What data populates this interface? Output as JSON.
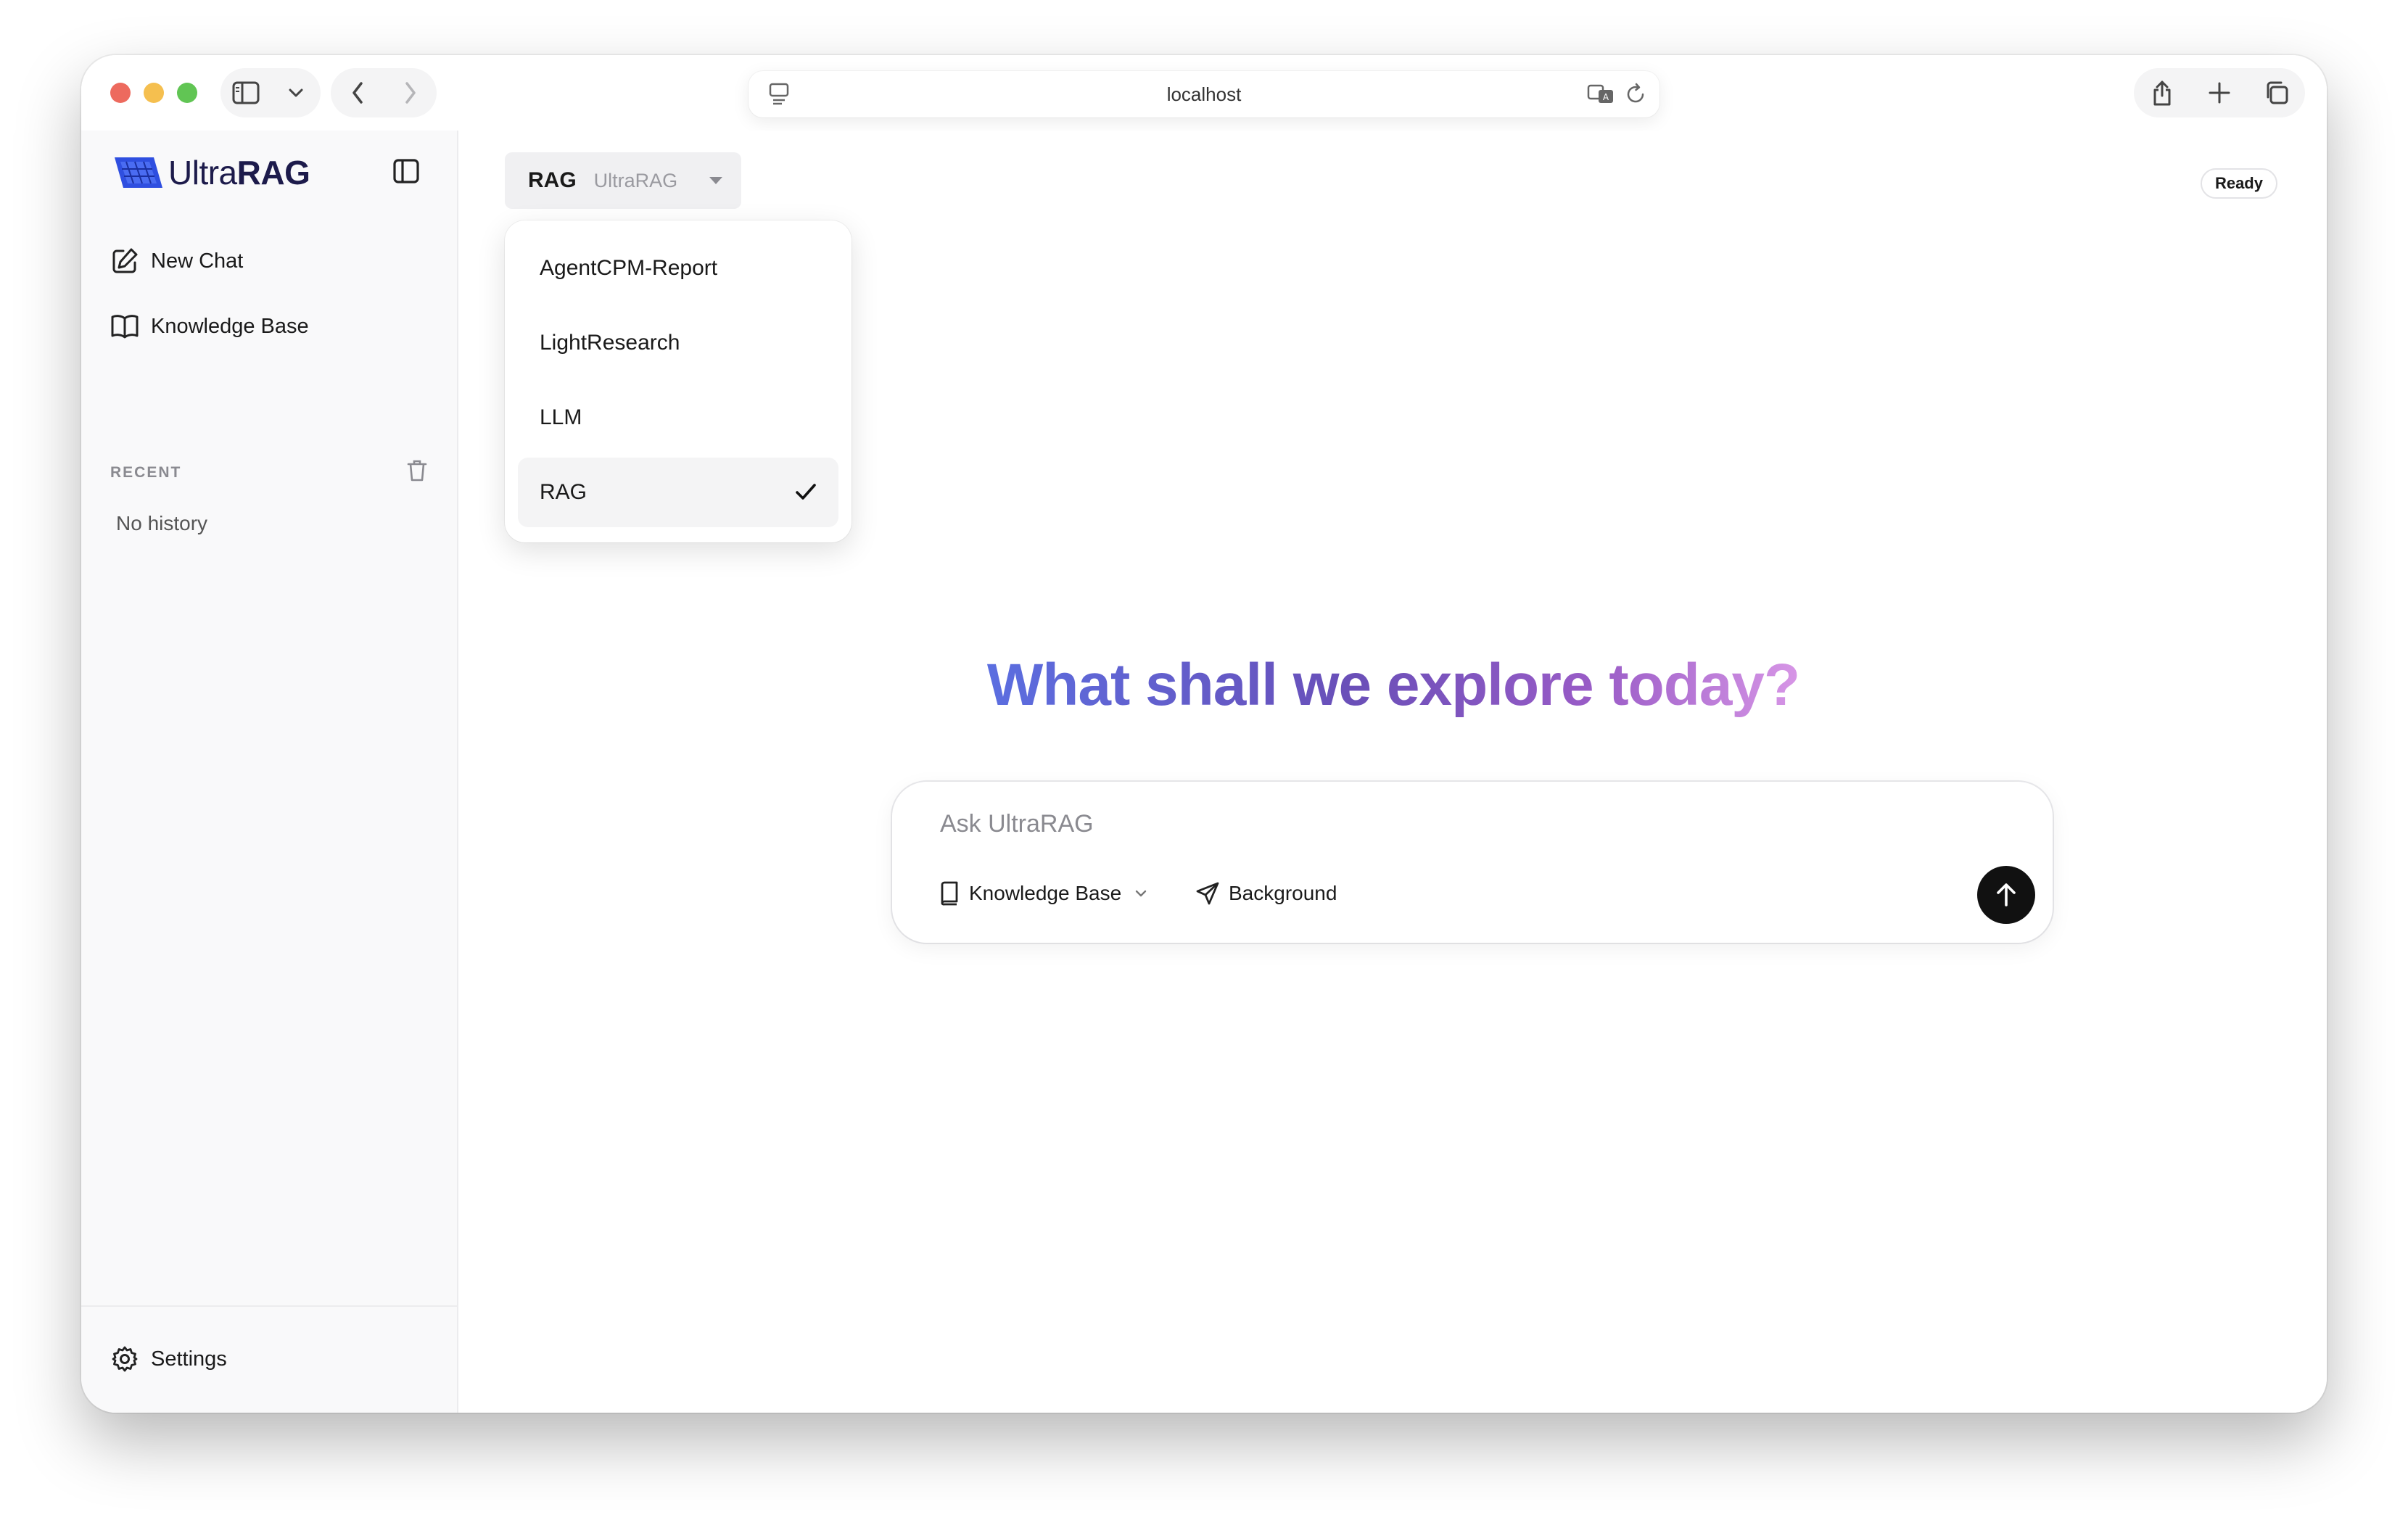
{
  "browser": {
    "url": "localhost"
  },
  "sidebar": {
    "logo_prefix": "Ultra",
    "logo_suffix": "RAG",
    "new_chat_label": "New Chat",
    "knowledge_base_label": "Knowledge Base",
    "recent_label": "RECENT",
    "no_history_label": "No history",
    "settings_label": "Settings"
  },
  "header": {
    "selected_model": "RAG",
    "selected_model_provider": "UltraRAG",
    "status": "Ready"
  },
  "model_dropdown": {
    "options": [
      {
        "label": "AgentCPM-Report",
        "selected": false
      },
      {
        "label": "LightResearch",
        "selected": false
      },
      {
        "label": "LLM",
        "selected": false
      },
      {
        "label": "RAG",
        "selected": true
      }
    ]
  },
  "main": {
    "headline": "What shall we explore today?",
    "composer_placeholder": "Ask UltraRAG",
    "knowledge_base_chip": "Knowledge Base",
    "background_chip": "Background"
  },
  "colors": {
    "send_button": "#111111",
    "headline_gradient_start": "#5b6ee0",
    "headline_gradient_end": "#d796e6",
    "logo_blue": "#2f4fe0"
  }
}
